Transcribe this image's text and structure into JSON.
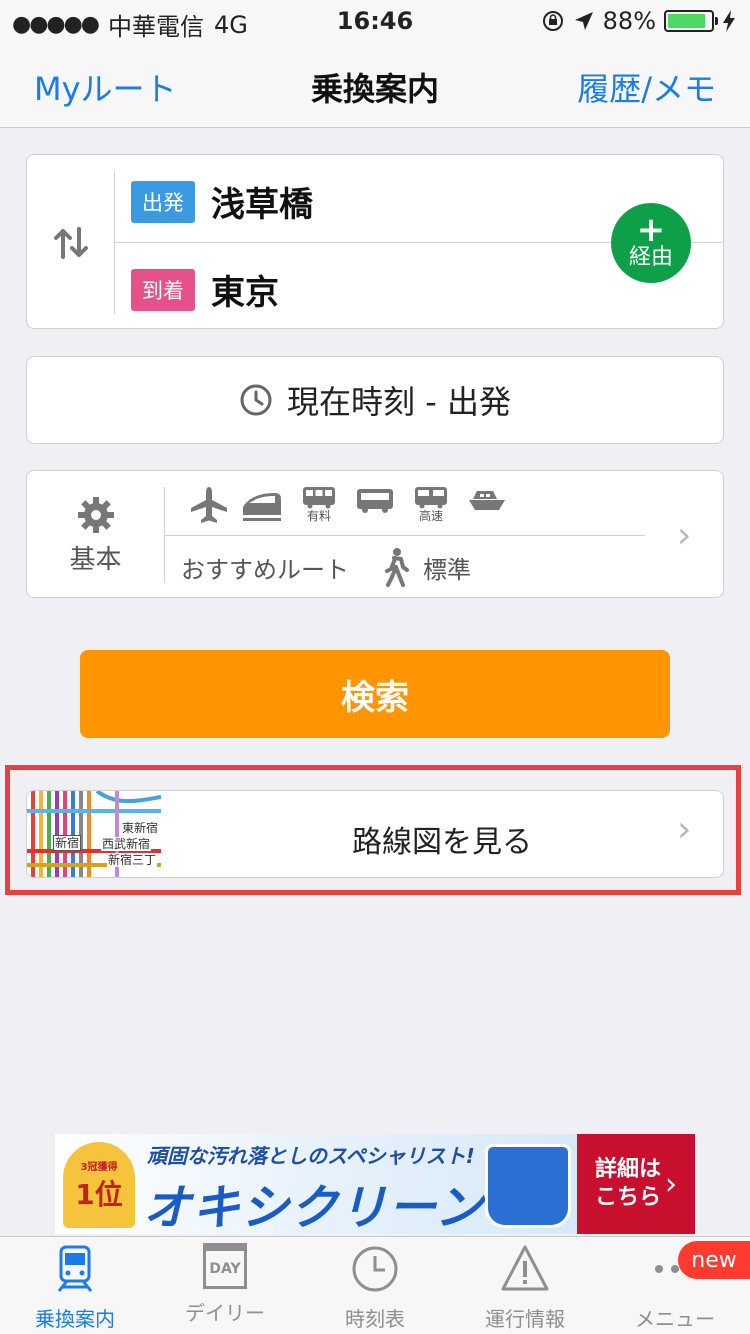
{
  "status": {
    "signal": "●●●●●",
    "carrier": "中華電信",
    "network": "4G",
    "time": "16:46",
    "battery": "88%",
    "battery_level": 0.88
  },
  "nav": {
    "left": "Myルート",
    "title": "乗換案内",
    "right": "履歴/メモ"
  },
  "route": {
    "from_tag": "出発",
    "from": "浅草橋",
    "to_tag": "到着",
    "to": "東京",
    "via_label": "経由"
  },
  "time": {
    "label": "現在時刻 - 出発"
  },
  "options": {
    "preset": "基本",
    "transport_sub": [
      "有料",
      "高速"
    ],
    "route_type": "おすすめルート",
    "walk_speed": "標準"
  },
  "search": {
    "label": "検索"
  },
  "map": {
    "label": "路線図を見る",
    "thumb_labels": [
      "新宿",
      "東新宿",
      "西武新宿",
      "新宿三丁"
    ]
  },
  "ad": {
    "badge_top": "3冠獲得",
    "badge_rank": "1位",
    "copy": "頑固な汚れ落としのスペシャリスト!",
    "brand": "オキシクリーン",
    "cta": "詳細は\nこちら"
  },
  "tabs": [
    {
      "label": "乗換案内"
    },
    {
      "label": "デイリー",
      "icon_text": "DAY"
    },
    {
      "label": "時刻表"
    },
    {
      "label": "運行情報"
    },
    {
      "label": "メニュー"
    }
  ],
  "badge": "new",
  "colors": {
    "accent": "#1a7ce8",
    "orange": "#ff9500",
    "green": "#0e9f49",
    "from_tag": "#3a9be3",
    "to_tag": "#e5518a",
    "highlight": "#e8403e"
  }
}
